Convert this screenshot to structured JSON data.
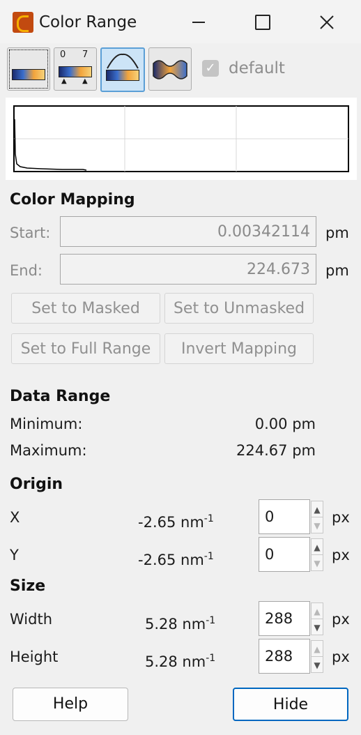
{
  "window": {
    "title": "Color Range",
    "minimize_icon": "minimize-icon",
    "maximize_icon": "maximize-icon",
    "close_icon": "close-icon"
  },
  "toolbar": {
    "modes": [
      {
        "icon": "full-range-mode-icon"
      },
      {
        "icon": "fixed-range-mode-icon",
        "digits": [
          "0",
          "7"
        ]
      },
      {
        "icon": "auto-range-mode-icon"
      },
      {
        "icon": "adaptive-mode-icon"
      }
    ],
    "default_label": "default",
    "default_checked": true
  },
  "color_mapping": {
    "heading": "Color Mapping",
    "start_label": "Start:",
    "start_value": "0.00342114",
    "start_unit": "pm",
    "end_label": "End:",
    "end_value": "224.673",
    "end_unit": "pm",
    "buttons": {
      "set_masked": "Set to Masked",
      "set_unmasked": "Set to Unmasked",
      "set_full": "Set to Full Range",
      "invert": "Invert Mapping"
    }
  },
  "data_range": {
    "heading": "Data Range",
    "minimum_label": "Minimum:",
    "minimum_value": "0.00 pm",
    "maximum_label": "Maximum:",
    "maximum_value": "224.67 pm"
  },
  "origin": {
    "heading": "Origin",
    "x_label": "X",
    "x_real": "-2.65 nm",
    "x_exp": "-1",
    "x_px": "0",
    "y_label": "Y",
    "y_real": "-2.65 nm",
    "y_exp": "-1",
    "y_px": "0",
    "unit": "px"
  },
  "size": {
    "heading": "Size",
    "width_label": "Width",
    "width_real": "5.28 nm",
    "width_exp": "-1",
    "width_px": "288",
    "height_label": "Height",
    "height_real": "5.28 nm",
    "height_exp": "-1",
    "height_px": "288",
    "unit": "px"
  },
  "footer": {
    "help_label": "Help",
    "hide_label": "Hide"
  }
}
